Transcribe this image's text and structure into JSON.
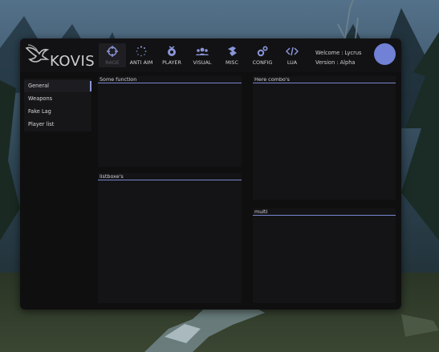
{
  "app": {
    "logo_text": "KOVIS"
  },
  "tabs": [
    {
      "label": "RAGE",
      "icon": "crosshair-icon",
      "active": true
    },
    {
      "label": "ANTI AIM",
      "icon": "spinner-icon",
      "active": false
    },
    {
      "label": "PLAYER",
      "icon": "player-icon",
      "active": false
    },
    {
      "label": "VISUAL",
      "icon": "users-icon",
      "active": false
    },
    {
      "label": "MISC",
      "icon": "misc-icon",
      "active": false
    },
    {
      "label": "CONFIG",
      "icon": "gears-icon",
      "active": false
    },
    {
      "label": "LUA",
      "icon": "code-icon",
      "active": false
    }
  ],
  "welcome": {
    "line1": "Welcome : Lycrus",
    "line2": "Version : Alpha"
  },
  "sidebar": {
    "items": [
      {
        "label": "General",
        "active": true
      },
      {
        "label": "Weapons"
      },
      {
        "label": "Fake Lag"
      },
      {
        "label": "Player list"
      }
    ]
  },
  "boxes": {
    "some_function": "Some function",
    "listboxes": "listboxe's",
    "combo": "Here combo's",
    "multi": "multi"
  },
  "colors": {
    "accent": "#7a86cf",
    "avatar": "#7181d6",
    "panel": "#0f0f10"
  }
}
